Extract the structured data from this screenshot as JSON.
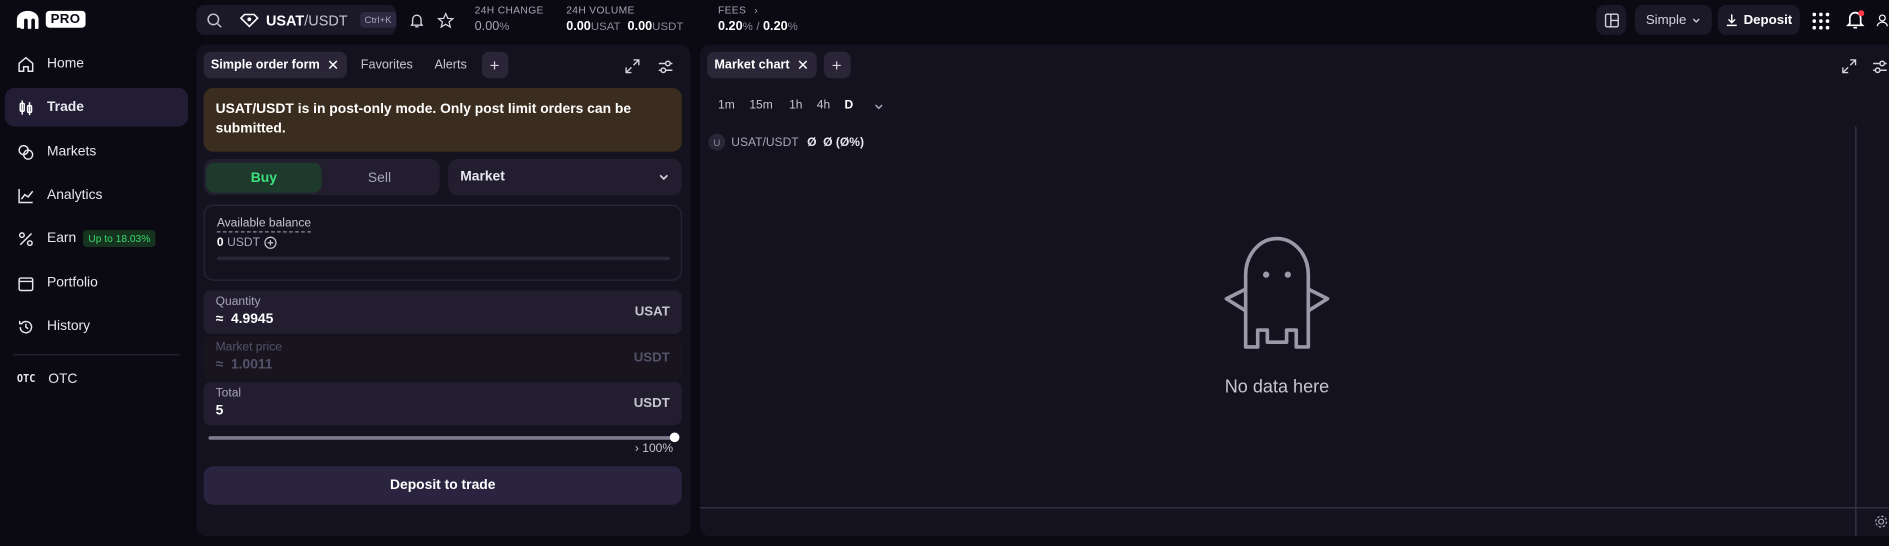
{
  "sidebar": {
    "logo_text": "PRO",
    "items": [
      {
        "label": "Home",
        "icon": "home-icon"
      },
      {
        "label": "Trade",
        "icon": "candles-icon"
      },
      {
        "label": "Markets",
        "icon": "coins-icon"
      },
      {
        "label": "Analytics",
        "icon": "chart-line-icon"
      },
      {
        "label": "Earn",
        "icon": "percent-icon",
        "badge": "Up to 18.03%"
      },
      {
        "label": "Portfolio",
        "icon": "wallet-icon"
      },
      {
        "label": "History",
        "icon": "history-icon"
      }
    ],
    "otc": {
      "mark": "OTC",
      "label": "OTC"
    }
  },
  "header": {
    "pair_base": "USAT",
    "pair_quote": "/USDT",
    "shortcut": "Ctrl+K",
    "change_label": "24H CHANGE",
    "change_value": "0.00",
    "change_unit": "%",
    "volume_label": "24H VOLUME",
    "volume_base_value": "0.00",
    "volume_base_unit": "USAT",
    "volume_quote_value": "0.00",
    "volume_quote_unit": "USDT",
    "fees_label": "FEES",
    "fees_maker": "0.20",
    "fees_taker": "0.20",
    "fees_unit": "%",
    "fees_sep": "/",
    "mode_label": "Simple",
    "deposit_label": "Deposit"
  },
  "order_panel": {
    "tabs": [
      {
        "label": "Simple order form",
        "active": true
      },
      {
        "label": "Favorites",
        "active": false
      },
      {
        "label": "Alerts",
        "active": false
      }
    ],
    "notice": "USAT/USDT is in post-only mode. Only post limit orders can be submitted.",
    "buy_label": "Buy",
    "sell_label": "Sell",
    "order_type": "Market",
    "balance_label": "Available balance",
    "balance_value": "0",
    "balance_unit": "USDT",
    "quantity_label": "Quantity",
    "quantity_prefix": "≈",
    "quantity_value": "4.9945",
    "quantity_unit": "USAT",
    "price_label": "Market price",
    "price_prefix": "≈",
    "price_value": "1.0011",
    "price_unit": "USDT",
    "total_label": "Total",
    "total_value": "5",
    "total_unit": "USDT",
    "slider_percent_label": "100%",
    "slider_fraction": 1.0,
    "deposit_to_trade": "Deposit to trade"
  },
  "chart_panel": {
    "tab_label": "Market chart",
    "timeframes": [
      "1m",
      "15m",
      "1h",
      "4h",
      "D"
    ],
    "active_timeframe": "D",
    "legend_avatar": "U",
    "legend_pair": "USAT/USDT",
    "legend_values": "Ø  Ø (Ø%)",
    "empty_text": "No data here"
  },
  "colors": {
    "background": "#0b0912",
    "panel": "#15121f",
    "buy_green": "#3ee07c",
    "notice_bg": "#3a2c1e",
    "accent_purple": "#2a2440"
  }
}
